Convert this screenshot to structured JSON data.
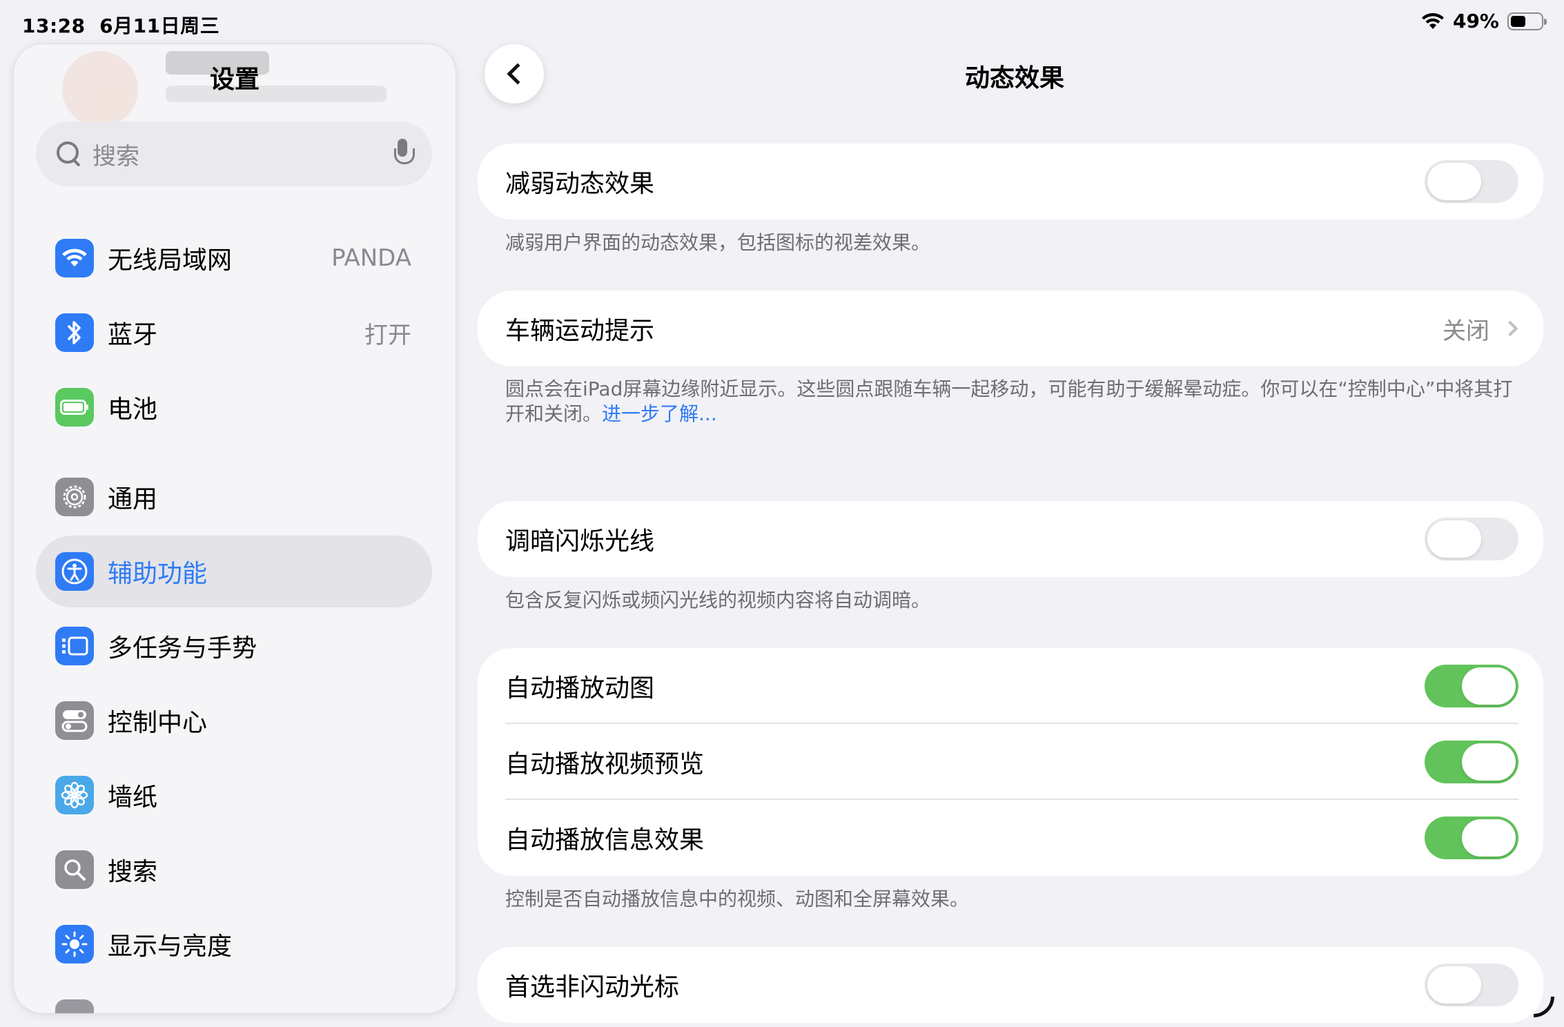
{
  "status_bar": {
    "time": "13:28",
    "date": "6月11日周三",
    "battery": "49%",
    "battery_fraction": 0.49
  },
  "sidebar": {
    "title": "设置",
    "search_placeholder": "搜索",
    "items": [
      {
        "label": "无线局域网",
        "value": "PANDA",
        "icon": "wifi-icon",
        "color": "#2f7bf5"
      },
      {
        "label": "蓝牙",
        "value": "打开",
        "icon": "bluetooth-icon",
        "color": "#2f7bf5"
      },
      {
        "label": "电池",
        "value": "",
        "icon": "battery-icon",
        "color": "#5ac95f"
      },
      {
        "label": "通用",
        "value": "",
        "icon": "gear-icon",
        "color": "#8e8e93"
      },
      {
        "label": "辅助功能",
        "value": "",
        "icon": "accessibility-icon",
        "color": "#2f7bf5",
        "selected": true
      },
      {
        "label": "多任务与手势",
        "value": "",
        "icon": "multitasking-icon",
        "color": "#2f7bf5"
      },
      {
        "label": "控制中心",
        "value": "",
        "icon": "control-center-icon",
        "color": "#8e8e93"
      },
      {
        "label": "墙纸",
        "value": "",
        "icon": "wallpaper-icon",
        "color": "#4aa8e8"
      },
      {
        "label": "搜索",
        "value": "",
        "icon": "search-app-icon",
        "color": "#8e8e93"
      },
      {
        "label": "显示与亮度",
        "value": "",
        "icon": "brightness-icon",
        "color": "#2f7bf5"
      }
    ]
  },
  "main": {
    "title": "动态效果",
    "reduce_motion": {
      "label": "减弱动态效果",
      "on": false,
      "footer": "减弱用户界面的动态效果，包括图标的视差效果。"
    },
    "vehicle_motion": {
      "label": "车辆运动提示",
      "value": "关闭",
      "footer": "圆点会在iPad屏幕边缘附近显示。这些圆点跟随车辆一起移动，可能有助于缓解晕动症。你可以在“控制中心”中将其打开和关闭。",
      "link": "进一步了解..."
    },
    "dim_flashing": {
      "label": "调暗闪烁光线",
      "on": false,
      "footer": "包含反复闪烁或频闪光线的视频内容将自动调暗。"
    },
    "autoplay": {
      "items": [
        {
          "label": "自动播放动图",
          "on": true
        },
        {
          "label": "自动播放视频预览",
          "on": true
        },
        {
          "label": "自动播放信息效果",
          "on": true
        }
      ],
      "footer": "控制是否自动播放信息中的视频、动图和全屏幕效果。"
    },
    "non_blinking_cursor": {
      "label": "首选非闪动光标",
      "on": false
    }
  }
}
